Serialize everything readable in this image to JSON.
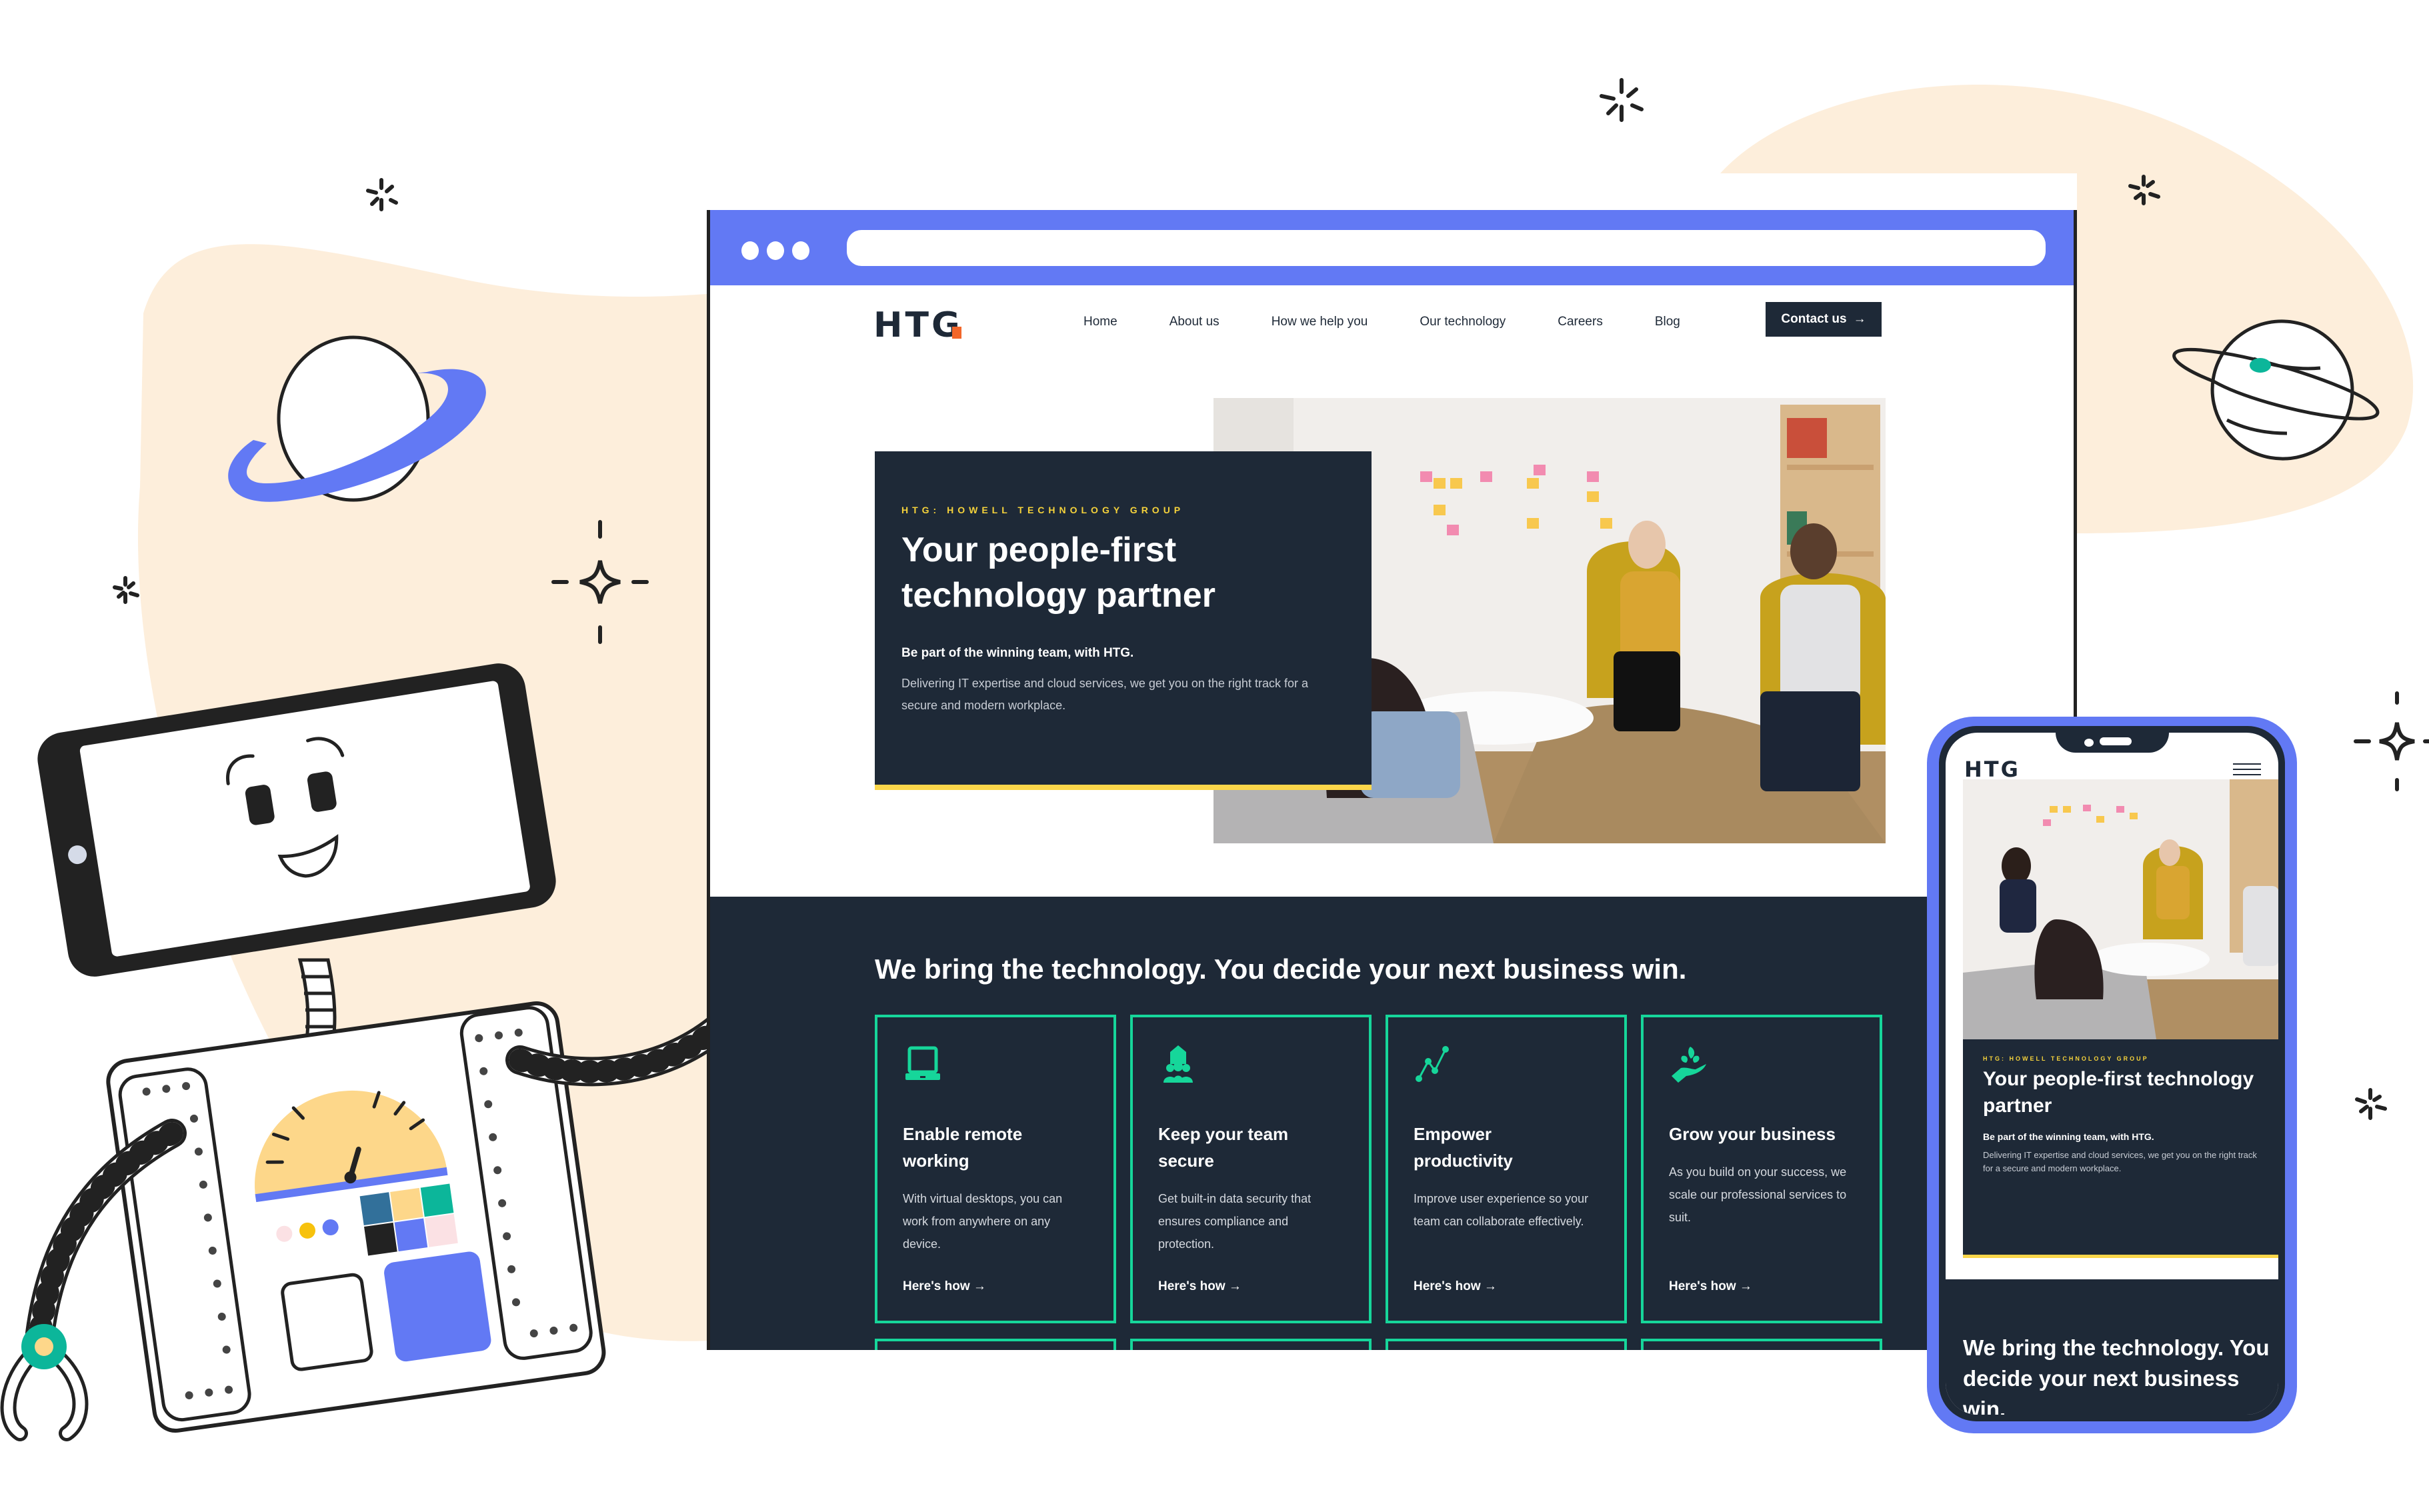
{
  "colors": {
    "brand_dark": "#1e2937",
    "accent_blue": "#6279f4",
    "accent_green": "#16d69a",
    "accent_yellow": "#fbd64a",
    "logo_orange": "#f2662a",
    "blob_cream": "#fdeedb"
  },
  "browser": {
    "url": ""
  },
  "site": {
    "logo": "HTG",
    "nav": [
      "Home",
      "About us",
      "How we help you",
      "Our technology",
      "Careers",
      "Blog"
    ],
    "contact_label": "Contact us",
    "contact_icon": "arrow-right-icon"
  },
  "hero": {
    "eyebrow": "HTG: HOWELL TECHNOLOGY GROUP",
    "title": "Your people-first technology partner",
    "subtitle": "Be part of the winning team, with HTG.",
    "body": "Delivering IT expertise and cloud services, we get you on the right track for a secure and modern workplace.",
    "photo_alt": "Team meeting in office lounge with yellow chairs"
  },
  "services": {
    "heading": "We bring the technology. You decide your next business win.",
    "cards": [
      {
        "icon": "laptop-icon",
        "title": "Enable remote working",
        "body": "With virtual desktops, you can work from anywhere on any device.",
        "link": "Here's how"
      },
      {
        "icon": "team-shield-icon",
        "title": "Keep your team secure",
        "body": "Get built-in data security that ensures compliance and protection.",
        "link": "Here's how"
      },
      {
        "icon": "line-chart-icon",
        "title": "Empower productivity",
        "body": "Improve user experience so your team can collaborate effectively.",
        "link": "Here's how"
      },
      {
        "icon": "hand-plant-icon",
        "title": "Grow your business",
        "body": "As you build on your success, we scale our professional services to suit.",
        "link": "Here's how"
      }
    ]
  },
  "mobile": {
    "logo": "HTG",
    "menu_icon": "hamburger-menu-icon",
    "eyebrow": "HTG: HOWELL TECHNOLOGY GROUP",
    "title": "Your people-first technology partner",
    "subtitle": "Be part of the winning team, with HTG.",
    "body": "Delivering IT expertise and cloud services, we get you on the right track for a secure and modern workplace.",
    "heading": "We bring the technology. You decide your next business win."
  }
}
